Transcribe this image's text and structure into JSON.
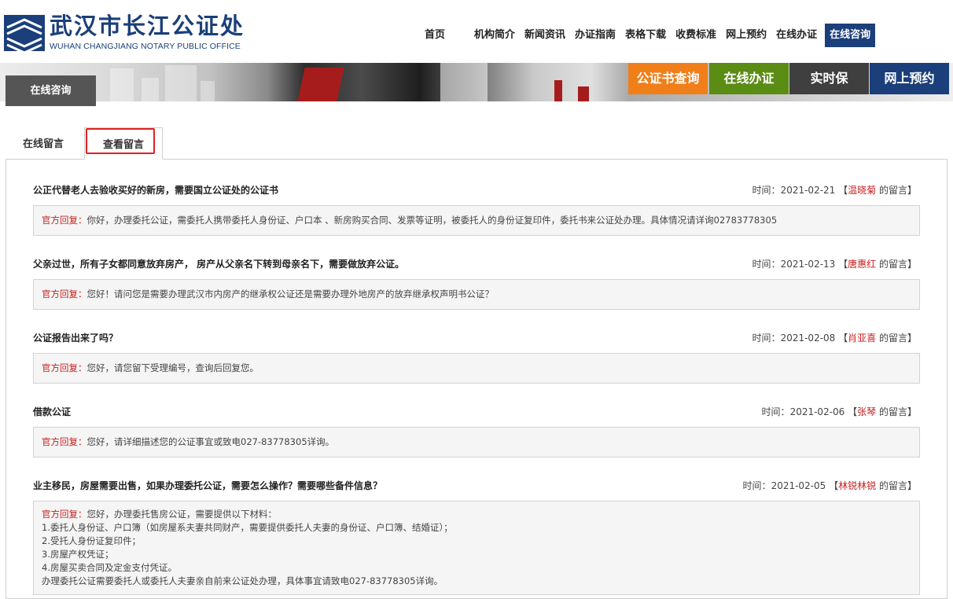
{
  "brand": {
    "name_cn": "武汉市长江公证处",
    "name_en": "WUHAN CHANGJIANG NOTARY PUBLIC OFFICE"
  },
  "nav": [
    "首页",
    "机构简介",
    "新闻资讯",
    "办证指南",
    "表格下载",
    "收费标准",
    "网上预约",
    "在线办证",
    "在线咨询"
  ],
  "nav_active_index": 8,
  "breadcrumb": "在线咨询",
  "quick_links": [
    {
      "label": "公证书查询",
      "color": "#f07f1a"
    },
    {
      "label": "在线办证",
      "color": "#5b8c14"
    },
    {
      "label": "实时保",
      "color": "#3f3f3f"
    },
    {
      "label": "网上预约",
      "color": "#1b3f7a"
    }
  ],
  "tabs": [
    "在线留言",
    "查看留言"
  ],
  "active_tab": 1,
  "meta_labels": {
    "time": "时间：",
    "suffix": "的留言】",
    "reply_tag": "官方回复："
  },
  "messages": [
    {
      "title": "公正代替老人去验收买好的新房，需要国立公证处的公证书",
      "date": "2021-02-21",
      "author": "温晓菊",
      "reply": "你好，办理委托公证，需委托人携带委托人身份证、户口本 、新房购买合同、发票等证明，被委托人的身份证复印件，委托书来公证处办理。具体情况请详询02783778305"
    },
    {
      "title": "父亲过世，所有子女都同意放弃房产， 房产从父亲名下转到母亲名下，需要做放弃公证。",
      "date": "2021-02-13",
      "author": "唐惠红",
      "reply": "您好！请问您是需要办理武汉市内房产的继承权公证还是需要办理外地房产的放弃继承权声明书公证？"
    },
    {
      "title": "公证报告出来了吗？",
      "date": "2021-02-08",
      "author": "肖亚喜",
      "reply": "您好，请您留下受理编号，查询后回复您。"
    },
    {
      "title": "借款公证",
      "date": "2021-02-06",
      "author": "张琴",
      "reply": "您好，请详细描述您的公证事宜或致电027-83778305详询。"
    },
    {
      "title": "业主移民，房屋需要出售，如果办理委托公证，需要怎么操作？需要哪些备件信息？",
      "date": "2021-02-05",
      "author": "林锐林锐",
      "reply": "您好，办理委托售房公证，需要提供以下材料：",
      "reply_lines": [
        "1.委托人身份证、户口簿（如房屋系夫妻共同财产，需要提供委托人夫妻的身份证、户口簿、结婚证）；",
        "2.受托人身份证复印件；",
        "3.房屋产权凭证；",
        "4.房屋买卖合同及定金支付凭证。",
        "办理委托公证需要委托人或委托人夫妻亲自前来公证处办理，具体事宜请致电027-83778305详询。"
      ]
    }
  ]
}
